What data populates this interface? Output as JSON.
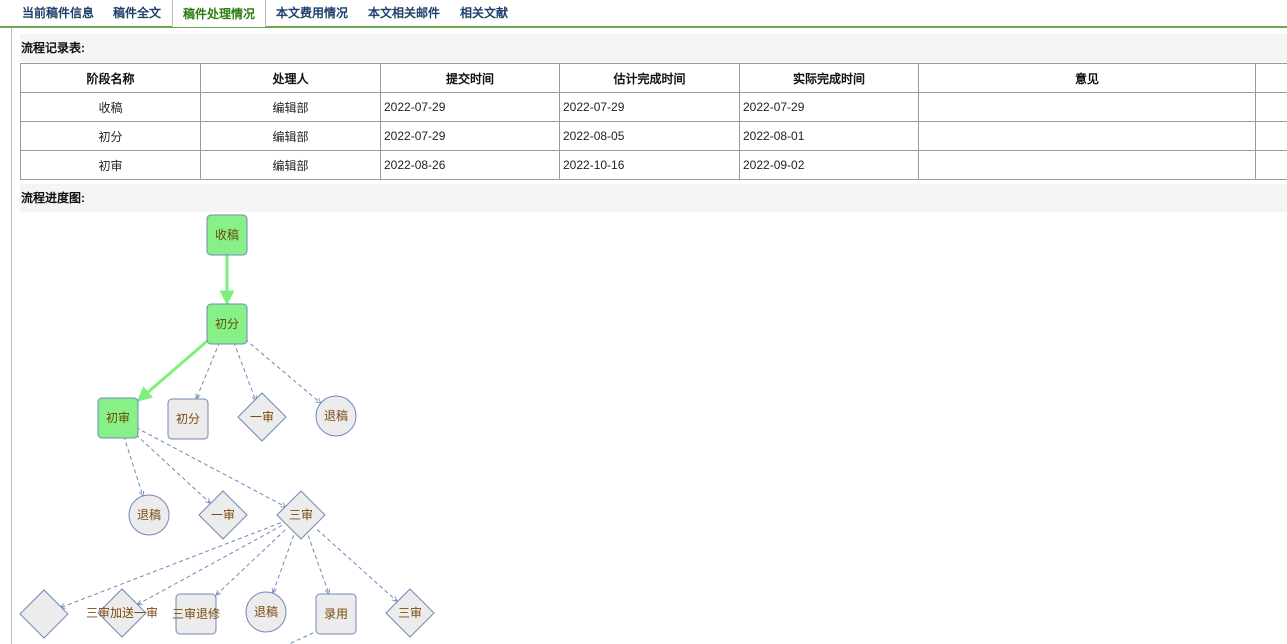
{
  "tabs": [
    {
      "label": "当前稿件信息",
      "active": false
    },
    {
      "label": "稿件全文",
      "active": false
    },
    {
      "label": "稿件处理情况",
      "active": true
    },
    {
      "label": "本文费用情况",
      "active": false
    },
    {
      "label": "本文相关邮件",
      "active": false
    },
    {
      "label": "相关文献",
      "active": false
    }
  ],
  "records": {
    "title": "流程记录表:",
    "headers": [
      "阶段名称",
      "处理人",
      "提交时间",
      "估计完成时间",
      "实际完成时间",
      "意见"
    ],
    "rows": [
      [
        "收稿",
        "编辑部",
        "2022-07-29",
        "2022-07-29",
        "2022-07-29",
        ""
      ],
      [
        "初分",
        "编辑部",
        "2022-07-29",
        "2022-08-05",
        "2022-08-01",
        ""
      ],
      [
        "初审",
        "编辑部",
        "2022-08-26",
        "2022-10-16",
        "2022-09-02",
        ""
      ]
    ]
  },
  "diagram": {
    "title": "流程进度图:",
    "colors": {
      "done_fill": "#88f088",
      "pending_fill": "#ececec",
      "stroke": "#6f88b8",
      "done_edge": "#7ef07e",
      "pending_edge": "#6f88b8",
      "label_done": "#6a4a00",
      "label_pending": "#7a4a10"
    },
    "nodes": [
      {
        "id": "n1",
        "label": "收稿",
        "shape": "rect",
        "done": true
      },
      {
        "id": "n2",
        "label": "初分",
        "shape": "rect",
        "done": true
      },
      {
        "id": "n3",
        "label": "初审",
        "shape": "rect",
        "done": true
      },
      {
        "id": "n4",
        "label": "初分",
        "shape": "rect",
        "done": false
      },
      {
        "id": "n5",
        "label": "一审",
        "shape": "diamond",
        "done": false
      },
      {
        "id": "n6",
        "label": "退稿",
        "shape": "circle",
        "done": false
      },
      {
        "id": "n7",
        "label": "退稿",
        "shape": "circle",
        "done": false
      },
      {
        "id": "n8",
        "label": "一审",
        "shape": "diamond",
        "done": false
      },
      {
        "id": "n9",
        "label": "三审",
        "shape": "diamond",
        "done": false
      },
      {
        "id": "n10",
        "label": "",
        "shape": "diamond",
        "done": false
      },
      {
        "id": "n11",
        "label": "三审加送一审",
        "shape": "diamond",
        "done": false
      },
      {
        "id": "n12",
        "label": "三审退修",
        "shape": "rect",
        "done": false
      },
      {
        "id": "n13",
        "label": "退稿",
        "shape": "circle",
        "done": false
      },
      {
        "id": "n14",
        "label": "录用",
        "shape": "rect",
        "done": false
      },
      {
        "id": "n15",
        "label": "三审",
        "shape": "diamond",
        "done": false
      }
    ],
    "edges": [
      {
        "from": "n1",
        "to": "n2",
        "done": true
      },
      {
        "from": "n2",
        "to": "n3",
        "done": true
      },
      {
        "from": "n2",
        "to": "n4",
        "done": false
      },
      {
        "from": "n2",
        "to": "n5",
        "done": false
      },
      {
        "from": "n2",
        "to": "n6",
        "done": false
      },
      {
        "from": "n3",
        "to": "n7",
        "done": false
      },
      {
        "from": "n3",
        "to": "n8",
        "done": false
      },
      {
        "from": "n3",
        "to": "n9",
        "done": false
      },
      {
        "from": "n9",
        "to": "n10",
        "done": false
      },
      {
        "from": "n9",
        "to": "n11",
        "done": false
      },
      {
        "from": "n9",
        "to": "n12",
        "done": false
      },
      {
        "from": "n9",
        "to": "n13",
        "done": false
      },
      {
        "from": "n9",
        "to": "n14",
        "done": false
      },
      {
        "from": "n9",
        "to": "n15",
        "done": false
      }
    ]
  }
}
